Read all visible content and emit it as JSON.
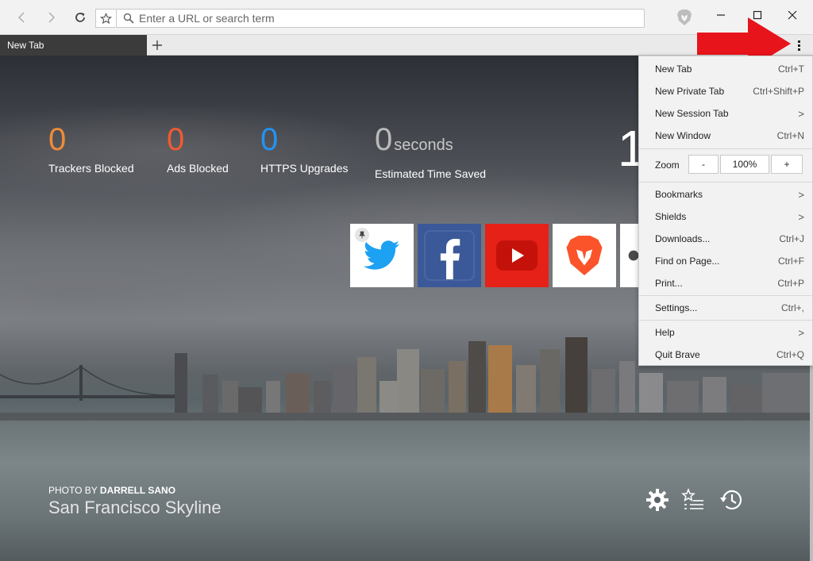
{
  "toolbar": {
    "url_placeholder": "Enter a URL or search term"
  },
  "tabs": [
    {
      "label": "New Tab",
      "active": true
    }
  ],
  "stats": {
    "trackers": {
      "value": "0",
      "label": "Trackers Blocked",
      "color": "#ef8b3a"
    },
    "ads": {
      "value": "0",
      "label": "Ads Blocked",
      "color": "#f05b31"
    },
    "https": {
      "value": "0",
      "label": "HTTPS Upgrades",
      "color": "#2493f0"
    },
    "time": {
      "value": "0",
      "unit": "seconds",
      "label": "Estimated Time Saved",
      "color": "#b9b9b9"
    }
  },
  "clock": "1",
  "top_sites": [
    {
      "name": "twitter",
      "color": "#1da1f2",
      "pinned": true
    },
    {
      "name": "facebook",
      "color": "#3b5998"
    },
    {
      "name": "youtube",
      "color": "#e62117"
    },
    {
      "name": "brave",
      "color": "#fb542b"
    },
    {
      "name": "github",
      "color": "#333333"
    }
  ],
  "background": {
    "credit_prefix": "PHOTO BY",
    "credit_name": "DARRELL SANO",
    "title": "San Francisco Skyline"
  },
  "menu": {
    "items": [
      {
        "label": "New Tab",
        "shortcut": "Ctrl+T"
      },
      {
        "label": "New Private Tab",
        "shortcut": "Ctrl+Shift+P"
      },
      {
        "label": "New Session Tab",
        "shortcut": ">"
      },
      {
        "label": "New Window",
        "shortcut": "Ctrl+N"
      }
    ],
    "zoom": {
      "label": "Zoom",
      "minus": "-",
      "value": "100%",
      "plus": "+"
    },
    "items2": [
      {
        "label": "Bookmarks",
        "shortcut": ">"
      },
      {
        "label": "Shields",
        "shortcut": ">"
      },
      {
        "label": "Downloads...",
        "shortcut": "Ctrl+J"
      },
      {
        "label": "Find on Page...",
        "shortcut": "Ctrl+F"
      },
      {
        "label": "Print...",
        "shortcut": "Ctrl+P"
      }
    ],
    "settings": {
      "label": "Settings...",
      "shortcut": "Ctrl+,"
    },
    "items3": [
      {
        "label": "Help",
        "shortcut": ">"
      },
      {
        "label": "Quit Brave",
        "shortcut": "Ctrl+Q"
      }
    ]
  },
  "colors": {
    "arrow": "#e8141c"
  }
}
